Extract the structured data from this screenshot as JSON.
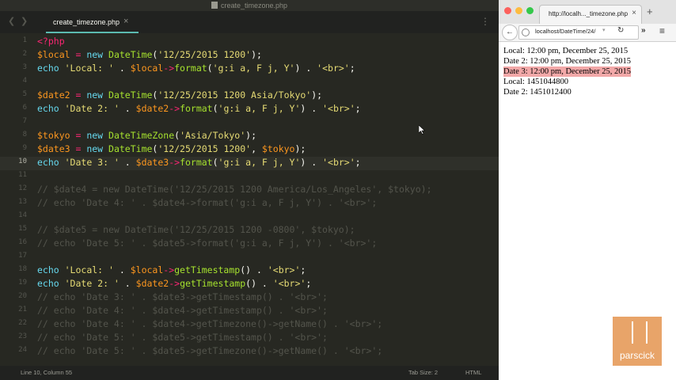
{
  "window": {
    "title": "create_timezone.php"
  },
  "editor": {
    "tab_label": "create_timezone.php",
    "tab_close": "×",
    "status": {
      "position": "Line 10, Column 55",
      "tab_size": "Tab Size: 2",
      "syntax": "HTML"
    }
  },
  "code_lines": [
    {
      "n": "1",
      "tokens": [
        {
          "t": "<?php",
          "c": "tag"
        }
      ]
    },
    {
      "n": "2",
      "tokens": [
        {
          "t": "$local",
          "c": "var"
        },
        {
          "t": " = ",
          "c": "op"
        },
        {
          "t": "new ",
          "c": "kw"
        },
        {
          "t": "DateTime",
          "c": "fn"
        },
        {
          "t": "(",
          "c": ""
        },
        {
          "t": "'12/25/2015 1200'",
          "c": "str"
        },
        {
          "t": ");",
          "c": ""
        }
      ]
    },
    {
      "n": "3",
      "tokens": [
        {
          "t": "echo ",
          "c": "kw"
        },
        {
          "t": "'Local: '",
          "c": "str"
        },
        {
          "t": " . ",
          "c": ""
        },
        {
          "t": "$local",
          "c": "var"
        },
        {
          "t": "->",
          "c": "op"
        },
        {
          "t": "format",
          "c": "fn"
        },
        {
          "t": "(",
          "c": ""
        },
        {
          "t": "'g:i a, F j, Y'",
          "c": "str"
        },
        {
          "t": ") . ",
          "c": ""
        },
        {
          "t": "'<br>'",
          "c": "str"
        },
        {
          "t": ";",
          "c": ""
        }
      ]
    },
    {
      "n": "4",
      "tokens": []
    },
    {
      "n": "5",
      "tokens": [
        {
          "t": "$date2",
          "c": "var"
        },
        {
          "t": " = ",
          "c": "op"
        },
        {
          "t": "new ",
          "c": "kw"
        },
        {
          "t": "DateTime",
          "c": "fn"
        },
        {
          "t": "(",
          "c": ""
        },
        {
          "t": "'12/25/2015 1200 Asia/Tokyo'",
          "c": "str"
        },
        {
          "t": ");",
          "c": ""
        }
      ]
    },
    {
      "n": "6",
      "tokens": [
        {
          "t": "echo ",
          "c": "kw"
        },
        {
          "t": "'Date 2: '",
          "c": "str"
        },
        {
          "t": " . ",
          "c": ""
        },
        {
          "t": "$date2",
          "c": "var"
        },
        {
          "t": "->",
          "c": "op"
        },
        {
          "t": "format",
          "c": "fn"
        },
        {
          "t": "(",
          "c": ""
        },
        {
          "t": "'g:i a, F j, Y'",
          "c": "str"
        },
        {
          "t": ") . ",
          "c": ""
        },
        {
          "t": "'<br>'",
          "c": "str"
        },
        {
          "t": ";",
          "c": ""
        }
      ]
    },
    {
      "n": "7",
      "tokens": []
    },
    {
      "n": "8",
      "tokens": [
        {
          "t": "$tokyo",
          "c": "var"
        },
        {
          "t": " = ",
          "c": "op"
        },
        {
          "t": "new ",
          "c": "kw"
        },
        {
          "t": "DateTimeZone",
          "c": "fn"
        },
        {
          "t": "(",
          "c": ""
        },
        {
          "t": "'Asia/Tokyo'",
          "c": "str"
        },
        {
          "t": ");",
          "c": ""
        }
      ]
    },
    {
      "n": "9",
      "tokens": [
        {
          "t": "$date3",
          "c": "var"
        },
        {
          "t": " = ",
          "c": "op"
        },
        {
          "t": "new ",
          "c": "kw"
        },
        {
          "t": "DateTime",
          "c": "fn"
        },
        {
          "t": "(",
          "c": ""
        },
        {
          "t": "'12/25/2015 1200'",
          "c": "str"
        },
        {
          "t": ", ",
          "c": ""
        },
        {
          "t": "$tokyo",
          "c": "var"
        },
        {
          "t": ");",
          "c": ""
        }
      ]
    },
    {
      "n": "10",
      "tokens": [
        {
          "t": "echo ",
          "c": "kw"
        },
        {
          "t": "'Date 3: '",
          "c": "str"
        },
        {
          "t": " . ",
          "c": ""
        },
        {
          "t": "$date3",
          "c": "var"
        },
        {
          "t": "->",
          "c": "op"
        },
        {
          "t": "format",
          "c": "fn"
        },
        {
          "t": "(",
          "c": ""
        },
        {
          "t": "'g:i a, F j, Y'",
          "c": "str"
        },
        {
          "t": ") . ",
          "c": ""
        },
        {
          "t": "'<br>'",
          "c": "str"
        },
        {
          "t": ";",
          "c": ""
        }
      ]
    },
    {
      "n": "11",
      "tokens": []
    },
    {
      "n": "12",
      "dim": true,
      "tokens": [
        {
          "t": "// $date4 = new DateTime('12/25/2015 1200 America/Los_Angeles', $tokyo);",
          "c": "cm"
        }
      ]
    },
    {
      "n": "13",
      "dim": true,
      "tokens": [
        {
          "t": "// echo 'Date 4: ' . $date4->format('g:i a, F j, Y') . '<br>';",
          "c": "cm"
        }
      ]
    },
    {
      "n": "14",
      "tokens": []
    },
    {
      "n": "15",
      "dim": true,
      "tokens": [
        {
          "t": "// $date5 = new DateTime('12/25/2015 1200 -0800', $tokyo);",
          "c": "cm"
        }
      ]
    },
    {
      "n": "16",
      "dim": true,
      "tokens": [
        {
          "t": "// echo 'Date 5: ' . $date5->format('g:i a, F j, Y') . '<br>';",
          "c": "cm"
        }
      ]
    },
    {
      "n": "17",
      "tokens": []
    },
    {
      "n": "18",
      "tokens": [
        {
          "t": "echo ",
          "c": "kw"
        },
        {
          "t": "'Local: '",
          "c": "str"
        },
        {
          "t": " . ",
          "c": ""
        },
        {
          "t": "$local",
          "c": "var"
        },
        {
          "t": "->",
          "c": "op"
        },
        {
          "t": "getTimestamp",
          "c": "fn"
        },
        {
          "t": "() . ",
          "c": ""
        },
        {
          "t": "'<br>'",
          "c": "str"
        },
        {
          "t": ";",
          "c": ""
        }
      ]
    },
    {
      "n": "19",
      "tokens": [
        {
          "t": "echo ",
          "c": "kw"
        },
        {
          "t": "'Date 2: '",
          "c": "str"
        },
        {
          "t": " . ",
          "c": ""
        },
        {
          "t": "$date2",
          "c": "var"
        },
        {
          "t": "->",
          "c": "op"
        },
        {
          "t": "getTimestamp",
          "c": "fn"
        },
        {
          "t": "() . ",
          "c": ""
        },
        {
          "t": "'<br>'",
          "c": "str"
        },
        {
          "t": ";",
          "c": ""
        }
      ]
    },
    {
      "n": "20",
      "dim": true,
      "tokens": [
        {
          "t": "// echo 'Date 3: ' . $date3->getTimestamp() . '<br>';",
          "c": "cm"
        }
      ]
    },
    {
      "n": "21",
      "dim": true,
      "tokens": [
        {
          "t": "// echo 'Date 4: ' . $date4->getTimestamp() . '<br>';",
          "c": "cm"
        }
      ]
    },
    {
      "n": "22",
      "dim": true,
      "tokens": [
        {
          "t": "// echo 'Date 4: ' . $date4->getTimezone()->getName() . '<br>';",
          "c": "cm"
        }
      ]
    },
    {
      "n": "23",
      "dim": true,
      "tokens": [
        {
          "t": "// echo 'Date 5: ' . $date5->getTimestamp() . '<br>';",
          "c": "cm"
        }
      ]
    },
    {
      "n": "24",
      "dim": true,
      "tokens": [
        {
          "t": "// echo 'Date 5: ' . $date5->getTimezone()->getName() . '<br>';",
          "c": "cm"
        }
      ]
    }
  ],
  "current_line": "10",
  "browser": {
    "tab_title": "http://localh..._timezone.php",
    "tab_close": "×",
    "new_tab": "+",
    "url": "localhost/DateTime/24/",
    "url_dropdown": "▾",
    "reload": "↻",
    "back": "←",
    "more": "»",
    "menu": "≡",
    "output": [
      {
        "text": "Local: 12:00 pm, December 25, 2015",
        "selected": false
      },
      {
        "text": "Date 2: 12:00 pm, December 25, 2015",
        "selected": false
      },
      {
        "text": "Date 3: 12:00 pm, December 25, 2015",
        "selected": true
      },
      {
        "text": "Local: 1451044800",
        "selected": false
      },
      {
        "text": "Date 2: 1451012400",
        "selected": false
      }
    ]
  },
  "logo": {
    "text": "parscick"
  },
  "colors": {
    "editor_bg": "#272822",
    "keyword": "#66d9ef",
    "operator": "#f92672",
    "variable": "#fd971f",
    "function": "#a6e22e",
    "string": "#e6db74",
    "tab_accent": "#5bbab0",
    "selection": "#f2a8a8",
    "logo": "#e69b59"
  }
}
